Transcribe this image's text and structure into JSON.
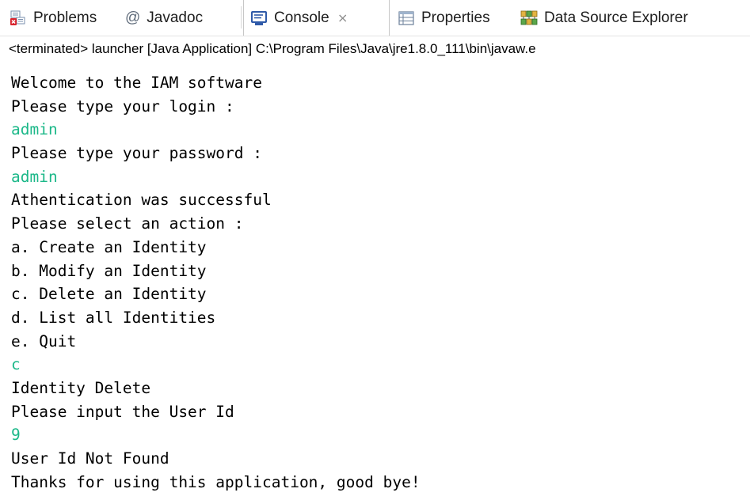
{
  "tabs": [
    {
      "label": "Problems",
      "icon": "problems-icon",
      "active": false
    },
    {
      "label": "Javadoc",
      "icon": "javadoc-at-icon",
      "active": false
    },
    {
      "label": "Console",
      "icon": "console-icon",
      "active": true,
      "close_glyph": "⨯"
    },
    {
      "label": "Properties",
      "icon": "properties-icon",
      "active": false
    },
    {
      "label": "Data Source Explorer",
      "icon": "data-source-explorer-icon",
      "active": false
    }
  ],
  "javadoc_glyph": "@",
  "status_line": "<terminated> launcher [Java Application] C:\\Program Files\\Java\\jre1.8.0_111\\bin\\javaw.e",
  "console_lines": [
    {
      "text": "Welcome to the IAM software",
      "kind": "output"
    },
    {
      "text": "Please type your login :",
      "kind": "output"
    },
    {
      "text": "admin",
      "kind": "input"
    },
    {
      "text": "Please type your password :",
      "kind": "output"
    },
    {
      "text": "admin",
      "kind": "input"
    },
    {
      "text": "Athentication was successful",
      "kind": "output"
    },
    {
      "text": "Please select an action :",
      "kind": "output"
    },
    {
      "text": "a. Create an Identity",
      "kind": "output"
    },
    {
      "text": "b. Modify an Identity",
      "kind": "output"
    },
    {
      "text": "c. Delete an Identity",
      "kind": "output"
    },
    {
      "text": "d. List all Identities",
      "kind": "output"
    },
    {
      "text": "e. Quit",
      "kind": "output"
    },
    {
      "text": "c",
      "kind": "input"
    },
    {
      "text": "Identity Delete",
      "kind": "output"
    },
    {
      "text": "Please input the User Id",
      "kind": "output"
    },
    {
      "text": "9",
      "kind": "input"
    },
    {
      "text": "User Id Not Found",
      "kind": "output"
    },
    {
      "text": "Thanks for using this application, good bye!",
      "kind": "output"
    }
  ],
  "colors": {
    "input_text": "#1cb889",
    "output_text": "#000000",
    "tab_text": "#1e1e1e"
  }
}
